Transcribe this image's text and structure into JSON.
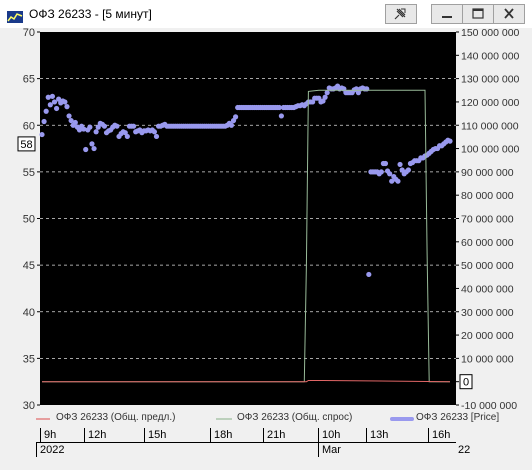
{
  "window": {
    "title": "ОФЗ 26233 - [5 минут]",
    "buttons": [
      "pin",
      "minimize",
      "maximize",
      "close"
    ]
  },
  "chart_data": {
    "type": "line",
    "title": "",
    "left_axis": {
      "ylim": [
        30,
        70
      ],
      "ticks": [
        30,
        35,
        40,
        45,
        50,
        55,
        60,
        65,
        70
      ],
      "current_marker": "58"
    },
    "right_axis": {
      "ylim": [
        -10000000,
        150000000
      ],
      "ticks": [
        -10000000,
        0,
        10000000,
        20000000,
        30000000,
        40000000,
        50000000,
        60000000,
        70000000,
        80000000,
        90000000,
        100000000,
        110000000,
        120000000,
        130000000,
        140000000,
        150000000
      ],
      "tick_labels": [
        "-10 000 000",
        "0",
        "10 000 000",
        "20 000 000",
        "30 000 000",
        "40 000 000",
        "50 000 000",
        "60 000 000",
        "70 000 000",
        "80 000 000",
        "90 000 000",
        "100 000 000",
        "110 000 000",
        "120 000 000",
        "130 000 000",
        "140 000 000",
        "150 000 000"
      ],
      "current_marker": "0"
    },
    "grid": true,
    "legend": [
      {
        "name": "ОФЗ 26233 (Общ. предл.)",
        "color": "#e06666"
      },
      {
        "name": "ОФЗ 26233 (Общ. спрос)",
        "color": "#99bb99"
      },
      {
        "name": "ОФЗ 26233 [Price]",
        "color": "#9999ee"
      }
    ],
    "x_axis": {
      "time_labels": [
        "9h",
        "12h",
        "15h",
        "18h",
        "21h",
        "10h",
        "13h",
        "16h"
      ],
      "date_labels": [
        "2022",
        "Mar",
        "22"
      ]
    },
    "series": [
      {
        "name": "ОФЗ 26233 [Price]",
        "axis": "left",
        "color": "#9999ee",
        "points": [
          [
            0,
            59
          ],
          [
            1,
            60.4
          ],
          [
            2,
            61.5
          ],
          [
            3,
            63
          ],
          [
            4,
            62.2
          ],
          [
            5,
            63.1
          ],
          [
            6,
            62.5
          ],
          [
            7,
            61.8
          ],
          [
            8,
            62.8
          ],
          [
            9,
            62.4
          ],
          [
            10,
            62.6
          ],
          [
            11,
            62.5
          ],
          [
            12,
            62
          ],
          [
            13,
            61
          ],
          [
            14,
            60.5
          ],
          [
            15,
            60
          ],
          [
            16,
            60.3
          ],
          [
            17,
            59.8
          ],
          [
            18,
            59.5
          ],
          [
            19,
            59.9
          ],
          [
            20,
            59.6
          ],
          [
            21,
            57.4
          ],
          [
            22,
            59.5
          ],
          [
            23,
            59.8
          ],
          [
            24,
            58
          ],
          [
            25,
            57.5
          ],
          [
            26,
            59.3
          ],
          [
            27,
            59.8
          ],
          [
            28,
            60.2
          ],
          [
            29,
            60.1
          ],
          [
            30,
            59.9
          ],
          [
            31,
            59.2
          ],
          [
            32,
            59.4
          ],
          [
            33,
            59.5
          ],
          [
            34,
            59.8
          ],
          [
            35,
            60
          ],
          [
            36,
            59.9
          ],
          [
            37,
            58.8
          ],
          [
            38,
            59.1
          ],
          [
            39,
            59.3
          ],
          [
            40,
            59.2
          ],
          [
            41,
            58.8
          ],
          [
            42,
            59.9
          ],
          [
            43,
            59.9
          ],
          [
            44,
            59.9
          ],
          [
            45,
            59.3
          ],
          [
            46,
            59.4
          ],
          [
            47,
            59.5
          ],
          [
            48,
            59.2
          ],
          [
            49,
            59.4
          ],
          [
            50,
            59.4
          ],
          [
            51,
            59.5
          ],
          [
            52,
            59.4
          ],
          [
            53,
            59.5
          ],
          [
            54,
            59.3
          ],
          [
            55,
            58.8
          ],
          [
            56,
            59.9
          ],
          [
            57,
            59.9
          ],
          [
            58,
            60
          ],
          [
            59,
            60.1
          ],
          [
            60,
            59.9
          ],
          [
            61,
            59.9
          ],
          [
            62,
            59.9
          ],
          [
            63,
            59.9
          ],
          [
            64,
            59.9
          ],
          [
            65,
            59.9
          ],
          [
            66,
            59.9
          ],
          [
            67,
            59.9
          ],
          [
            68,
            59.9
          ],
          [
            69,
            59.9
          ],
          [
            70,
            59.9
          ],
          [
            71,
            59.9
          ],
          [
            72,
            59.9
          ],
          [
            73,
            59.9
          ],
          [
            74,
            59.9
          ],
          [
            75,
            59.9
          ],
          [
            76,
            59.9
          ],
          [
            77,
            59.9
          ],
          [
            78,
            59.9
          ],
          [
            79,
            59.9
          ],
          [
            80,
            59.9
          ],
          [
            81,
            59.9
          ],
          [
            82,
            59.9
          ],
          [
            83,
            59.9
          ],
          [
            84,
            59.9
          ],
          [
            85,
            59.9
          ],
          [
            86,
            59.9
          ],
          [
            87,
            59.9
          ],
          [
            88,
            59.9
          ],
          [
            89,
            60
          ],
          [
            90,
            60.2
          ],
          [
            91,
            60
          ],
          [
            92,
            60.5
          ],
          [
            93,
            60.9
          ],
          [
            94,
            61.9
          ],
          [
            95,
            61.9
          ],
          [
            96,
            61.9
          ],
          [
            97,
            61.9
          ],
          [
            98,
            61.9
          ],
          [
            99,
            61.9
          ],
          [
            100,
            61.9
          ],
          [
            101,
            61.9
          ],
          [
            102,
            61.9
          ],
          [
            103,
            61.9
          ],
          [
            104,
            61.9
          ],
          [
            105,
            61.9
          ],
          [
            106,
            61.9
          ],
          [
            107,
            61.9
          ],
          [
            108,
            61.9
          ],
          [
            109,
            61.9
          ],
          [
            110,
            61.9
          ],
          [
            111,
            61.9
          ],
          [
            112,
            61.9
          ],
          [
            113,
            61.9
          ],
          [
            114,
            61.9
          ],
          [
            115,
            61
          ],
          [
            116,
            61.9
          ],
          [
            117,
            61.9
          ],
          [
            118,
            61.9
          ],
          [
            119,
            61.9
          ],
          [
            120,
            61.9
          ],
          [
            121,
            61.9
          ],
          [
            122,
            62
          ],
          [
            123,
            62.1
          ],
          [
            124,
            62.1
          ],
          [
            125,
            62.2
          ],
          [
            126,
            62.1
          ],
          [
            127,
            62.3
          ],
          [
            128,
            62.5
          ],
          [
            129,
            62.5
          ],
          [
            130,
            62.5
          ],
          [
            131,
            62.9
          ],
          [
            132,
            62.9
          ],
          [
            133,
            62.9
          ],
          [
            134,
            62.5
          ],
          [
            135,
            62.6
          ],
          [
            136,
            63
          ],
          [
            137,
            63.5
          ],
          [
            138,
            64
          ],
          [
            139,
            63.9
          ],
          [
            140,
            63.9
          ],
          [
            141,
            64
          ],
          [
            142,
            64.2
          ],
          [
            143,
            63.9
          ],
          [
            144,
            64
          ],
          [
            145,
            63.9
          ],
          [
            146,
            63.5
          ],
          [
            147,
            63.5
          ],
          [
            148,
            63.5
          ],
          [
            149,
            63.5
          ],
          [
            150,
            63.8
          ],
          [
            151,
            63.9
          ],
          [
            152,
            63.5
          ],
          [
            153,
            63.9
          ],
          [
            154,
            64
          ],
          [
            155,
            63.9
          ],
          [
            156,
            63.9
          ],
          [
            157,
            44
          ],
          [
            158,
            55
          ],
          [
            159,
            55
          ],
          [
            160,
            55
          ],
          [
            161,
            55
          ],
          [
            162,
            54.8
          ],
          [
            163,
            55
          ],
          [
            164,
            55.9
          ],
          [
            165,
            55.9
          ],
          [
            166,
            55.1
          ],
          [
            167,
            54.8
          ],
          [
            168,
            54
          ],
          [
            169,
            54.5
          ],
          [
            170,
            54.2
          ],
          [
            171,
            54
          ],
          [
            172,
            55.8
          ],
          [
            173,
            55.2
          ],
          [
            174,
            54.8
          ],
          [
            175,
            55
          ],
          [
            176,
            55.2
          ],
          [
            177,
            55.9
          ],
          [
            178,
            56
          ],
          [
            179,
            56.2
          ],
          [
            180,
            56.2
          ],
          [
            181,
            56.2
          ],
          [
            182,
            56.5
          ],
          [
            183,
            56.5
          ],
          [
            184,
            56.7
          ],
          [
            185,
            56.8
          ],
          [
            186,
            57
          ],
          [
            187,
            57.2
          ],
          [
            188,
            57.4
          ],
          [
            189,
            57.5
          ],
          [
            190,
            57.5
          ],
          [
            191,
            57.8
          ],
          [
            192,
            57.8
          ],
          [
            193,
            58
          ],
          [
            194,
            58.2
          ],
          [
            195,
            58.4
          ],
          [
            196,
            58.3
          ]
        ]
      },
      {
        "name": "ОФЗ 26233 (Общ. спрос)",
        "axis": "right",
        "color": "#99bb99",
        "points": [
          [
            0,
            0
          ],
          [
            126,
            0
          ],
          [
            127,
            50000000
          ],
          [
            128,
            124500000
          ],
          [
            133,
            125000000
          ],
          [
            183,
            125000000
          ],
          [
            184,
            125000000
          ],
          [
            185,
            55000000
          ],
          [
            186,
            0
          ],
          [
            196,
            0
          ]
        ]
      },
      {
        "name": "ОФЗ 26233 (Общ. предл.)",
        "axis": "right",
        "color": "#e06666",
        "points": [
          [
            0,
            0
          ],
          [
            126,
            0
          ],
          [
            127,
            0
          ],
          [
            128,
            500000
          ],
          [
            135,
            500000
          ],
          [
            196,
            0
          ]
        ]
      }
    ]
  }
}
